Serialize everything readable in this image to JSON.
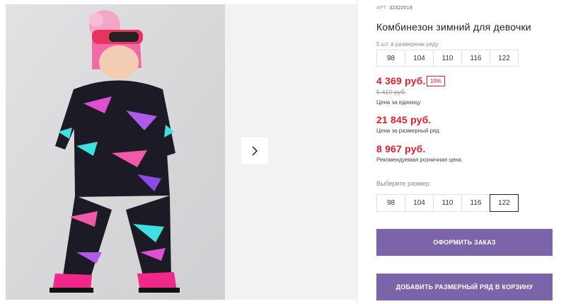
{
  "gallery": {
    "next_icon": "chevron-right-icon",
    "colors": {
      "background": "#f2f2f2",
      "photo_bg": "#d9d9db"
    }
  },
  "product": {
    "article_label": "АРТ:",
    "article_number": "32322019",
    "title": "Комбинезон зимний для девочки",
    "pack_label": "5 шт. в размерном ряду",
    "pack_sizes": [
      "98",
      "104",
      "110",
      "116",
      "122"
    ],
    "unit_price": "4 369 руб.",
    "discount": "19%",
    "old_price": "5 410 руб.",
    "unit_price_caption": "Цена за единицу",
    "pack_price": "21 845 руб.",
    "pack_price_caption": "Цена за размерный ряд",
    "retail_price": "8 967 руб.",
    "retail_price_caption": "Рекомендуемая розничная цена",
    "choose_size_label": "Выберите размер:",
    "size_options": [
      "98",
      "104",
      "110",
      "116",
      "122"
    ],
    "selected_size": "122"
  },
  "actions": {
    "order_label": "ОФОРМИТЬ ЗАКАЗ",
    "add_pack_label": "ДОБАВИТЬ РАЗМЕРНЫЙ РЯД В КОРЗИНУ"
  },
  "colors": {
    "accent_button": "#7b64a8",
    "price_red": "#e0202a"
  }
}
